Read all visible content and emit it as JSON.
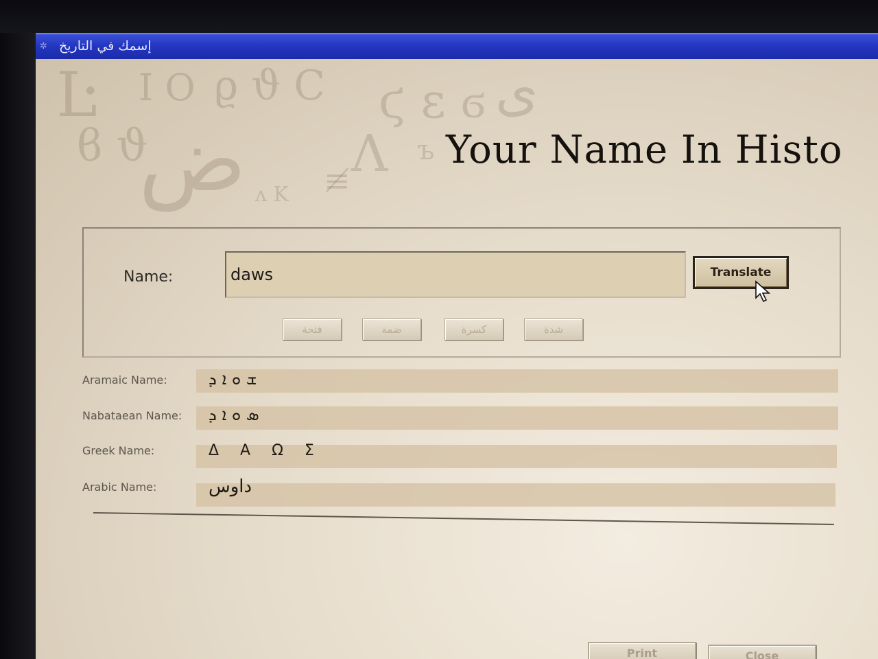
{
  "window": {
    "title": "إسمك في التاريخ"
  },
  "app": {
    "title": "Your Name In Histo"
  },
  "name_form": {
    "label": "Name:",
    "input_value": "daws",
    "translate_label": "Translate",
    "diacritics": [
      "فتحة",
      "ضمة",
      "كسرة",
      "شدة"
    ]
  },
  "results": [
    {
      "label": "Aramaic Name:",
      "value": "ܫ ܘ ܐ ܕ"
    },
    {
      "label": "Nabataean Name:",
      "value": "ܣ ܘ ܐ ܕ"
    },
    {
      "label": "Greek Name:",
      "value": "Δ Α Ω Σ"
    },
    {
      "label": "Arabic Name:",
      "value": "داوس"
    }
  ],
  "footer": {
    "print_label": "Print",
    "close_label": "Close"
  }
}
